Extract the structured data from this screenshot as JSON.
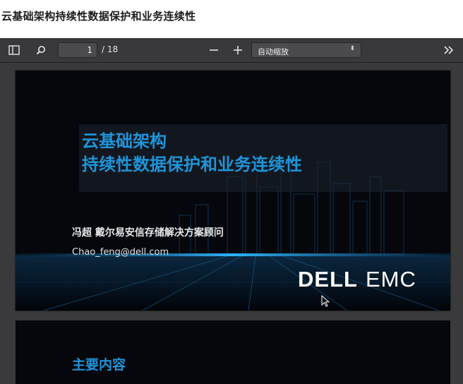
{
  "page": {
    "heading": "云基础架构持续性数据保护和业务连续性"
  },
  "toolbar": {
    "sidebar_icon": "sidebar-toggle-icon",
    "search_icon": "search-icon",
    "page_number": "1",
    "page_total": "/ 18",
    "zoom_out_icon": "minus-icon",
    "zoom_in_icon": "plus-icon",
    "zoom_value": "自动缩放",
    "more_icon": "double-chevron-right-icon"
  },
  "slides": [
    {
      "title_line1": "云基础架构",
      "title_line2": "持续性数据保护和业务连续性",
      "presenter": "冯超 戴尔易安信存储解决方案顾问",
      "email": "Chao_feng@dell.com",
      "logo_part1": "DELL",
      "logo_part2": "EMC"
    },
    {
      "title": "主要内容"
    }
  ],
  "colors": {
    "accent": "#1f94d8",
    "toolbar_bg": "#38383d",
    "viewer_bg": "#3a3a3c",
    "slide_bg": "#05070c"
  }
}
